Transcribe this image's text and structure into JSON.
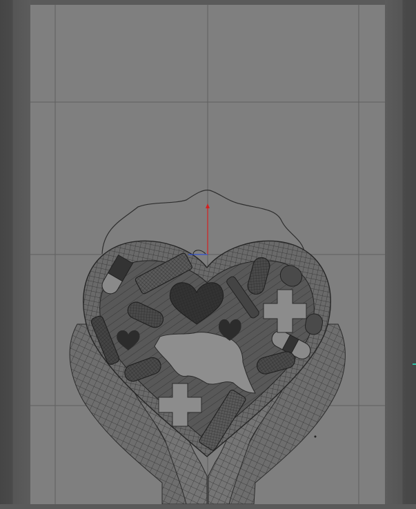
{
  "app": {
    "name": "",
    "view": "top"
  },
  "viewport": {
    "background": "#7f7f7f",
    "grid_color": "#5f5f5f",
    "wire_color": "#2b2b2b",
    "solid_color": "#3a3a3a",
    "axis_y_color": "#d42020",
    "axis_x_color": "#3050d0",
    "object": "heart-in-hands-relief",
    "icons": [
      "pill",
      "capsule",
      "bandage",
      "cross",
      "heart",
      "map-island"
    ]
  },
  "status": {
    "edge_marker_color": "#2ec4a8"
  }
}
